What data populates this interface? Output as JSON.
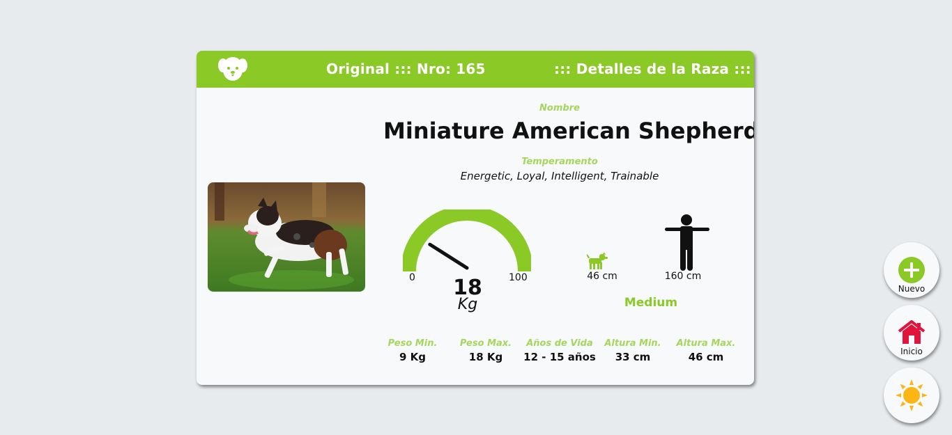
{
  "header": {
    "title": "Original ::: Nro: 165",
    "section": "::: Detalles de la Raza :::",
    "logo_icon": "dog-face-icon"
  },
  "breed": {
    "name_caption": "Nombre",
    "name": "Miniature American Shepherd",
    "temperament_caption": "Temperamento",
    "temperament": "Energetic, Loyal, Intelligent, Trainable",
    "photo_icon": "dog-photo"
  },
  "gauge": {
    "min_label": "0",
    "max_label": "100",
    "value": "18",
    "unit": "Kg",
    "min": 0,
    "max": 100,
    "reading": 18,
    "color": "#8ac926"
  },
  "height_compare": {
    "dog_height": "46 cm",
    "person_height": "160 cm",
    "size_label": "Medium"
  },
  "stats": [
    {
      "label": "Peso Min.",
      "value": "9 Kg"
    },
    {
      "label": "Peso Max.",
      "value": "18 Kg"
    },
    {
      "label": "Años de Vida",
      "value": "12 - 15 años"
    },
    {
      "label": "Altura Min.",
      "value": "33 cm"
    },
    {
      "label": "Altura Max.",
      "value": "46 cm"
    }
  ],
  "fabs": {
    "new_label": "Nuevo",
    "home_label": "Inicio",
    "new_icon": "plus-circle-icon",
    "home_icon": "house-icon",
    "theme_icon": "sun-icon"
  },
  "colors": {
    "accent": "#8ac926",
    "caption": "#a6d65e",
    "home": "#e0143c",
    "sun": "#fbb514"
  }
}
